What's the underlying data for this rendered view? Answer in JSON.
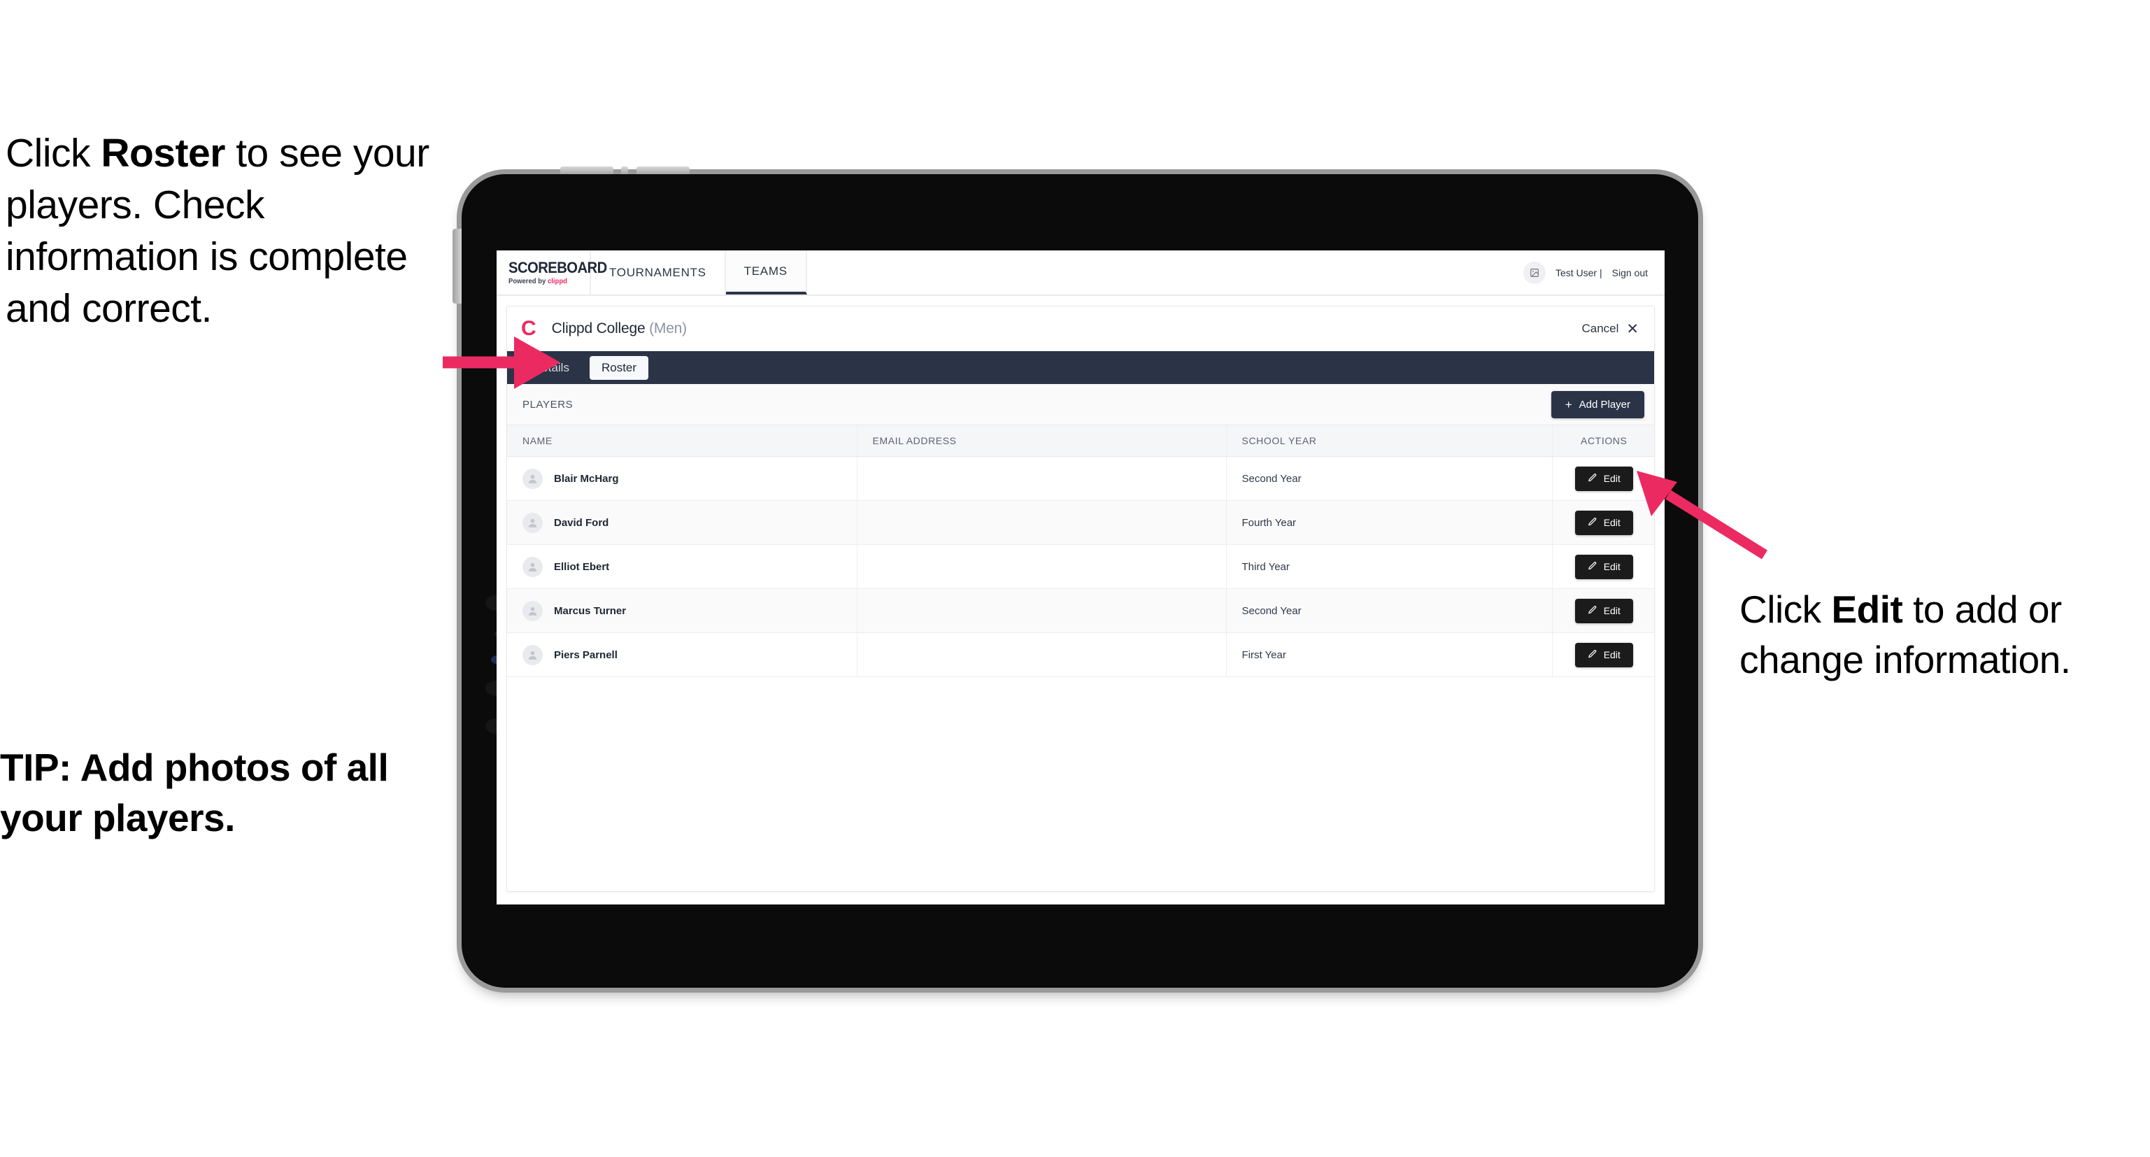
{
  "annotations": {
    "left_top": {
      "pre": "Click ",
      "bold": "Roster",
      "post": " to see your players. Check information is complete and correct."
    },
    "left_tip": "TIP: Add photos of all your players.",
    "right": {
      "pre": "Click ",
      "bold": "Edit",
      "post": " to add or change information."
    }
  },
  "app": {
    "brand": {
      "title": "SCOREBOARD",
      "powered_prefix": "Powered by ",
      "powered_name": "clippd"
    },
    "nav_tabs": [
      {
        "label": "TOURNAMENTS",
        "active": false
      },
      {
        "label": "TEAMS",
        "active": true
      }
    ],
    "user": {
      "avatar_icon": "image-placeholder-icon",
      "name": "Test User |",
      "sign_out": "Sign out"
    },
    "card": {
      "team_mark": "C",
      "team_name": "Clippd College",
      "team_gender": "(Men)",
      "cancel_label": "Cancel",
      "cancel_icon": "close-icon",
      "sub_tabs": [
        {
          "label": "Details",
          "active": false
        },
        {
          "label": "Roster",
          "active": true
        }
      ],
      "players_label": "PLAYERS",
      "add_player_label": "Add Player",
      "add_player_icon": "plus-icon",
      "table": {
        "columns": [
          "NAME",
          "EMAIL ADDRESS",
          "SCHOOL YEAR",
          "ACTIONS"
        ],
        "rows": [
          {
            "name": "Blair McHarg",
            "email": "",
            "school_year": "Second Year",
            "action": "Edit"
          },
          {
            "name": "David Ford",
            "email": "",
            "school_year": "Fourth Year",
            "action": "Edit"
          },
          {
            "name": "Elliot Ebert",
            "email": "",
            "school_year": "Third Year",
            "action": "Edit"
          },
          {
            "name": "Marcus Turner",
            "email": "",
            "school_year": "Second Year",
            "action": "Edit"
          },
          {
            "name": "Piers Parnell",
            "email": "",
            "school_year": "First Year",
            "action": "Edit"
          }
        ]
      }
    }
  },
  "colors": {
    "accent_pink": "#ec2a62",
    "navy": "#2b3446",
    "dark_button": "#1b1b1b",
    "device_body": "#0b0b0b"
  }
}
